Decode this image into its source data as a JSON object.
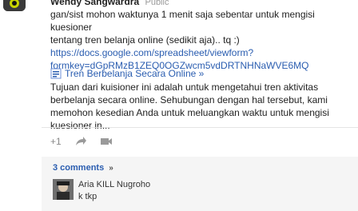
{
  "post": {
    "author": "Wendy Sangwardra",
    "time": "Public",
    "text_line1": "gan/sist mohon waktunya 1 menit saja sebentar untuk mengisi kuesioner",
    "text_line2": "tentang tren belanja online (sedikit aja).. tq :)",
    "link_line1": "https://docs.google.com/spreadsheet/viewform?",
    "link_line2": "formkey=dGpRMzB1ZEQ0OGZwcm5vdDRTNHNaWVE6MQ"
  },
  "share": {
    "title": "Tren Berbelanja Secara Online »",
    "description": "Tujuan dari kuisioner ini adalah untuk mengetahui tren aktivitas berbelanja secara online. Sehubungan dengan hal tersebut, kami memohon kesedian Anda untuk meluangkan waktu untuk mengisi kuesioner in..."
  },
  "actions": {
    "plus_one": "+1",
    "share_icon": "share-arrow-icon",
    "hangout_icon": "video-icon"
  },
  "comments": {
    "count_label": "3 comments",
    "toggle_icon": "chevron-double-down-icon",
    "items": [
      {
        "author": "Aria KILL Nugroho",
        "text": "k tkp"
      }
    ]
  }
}
